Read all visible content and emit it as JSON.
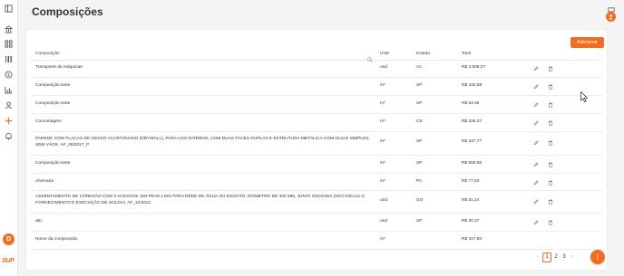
{
  "page": {
    "title": "Composições"
  },
  "brand": {
    "name": "SUP",
    "accent": "#f26d21"
  },
  "user": {
    "initial": "D"
  },
  "sidebar": {
    "items": [
      {
        "icon": "panel-toggle-icon"
      },
      {
        "icon": "bank-icon"
      },
      {
        "icon": "grid-icon"
      },
      {
        "icon": "barcode-icon"
      },
      {
        "icon": "dollar-icon"
      },
      {
        "icon": "bar-chart-icon"
      },
      {
        "icon": "user-icon"
      },
      {
        "icon": "plus-icon"
      },
      {
        "icon": "bell-icon"
      }
    ]
  },
  "toolbar": {
    "add_label": "Adicionar"
  },
  "table": {
    "headers": {
      "composicao": "Composição",
      "und": "UND",
      "estado": "Estado",
      "total": "Total"
    },
    "rows": [
      {
        "composicao": "Transporte de máquinas",
        "und": "und",
        "estado": "AC",
        "total": "R$ 3.508,07"
      },
      {
        "composicao": "Composição teste",
        "und": "m³",
        "estado": "SP",
        "total": "R$ 432,88"
      },
      {
        "composicao": "Composição teste",
        "und": "m³",
        "estado": "SP",
        "total": "R$ 53,48"
      },
      {
        "composicao": "Concretagem",
        "und": "m³",
        "estado": "CE",
        "total": "R$ 228,27"
      },
      {
        "composicao": "PAREDE COM PLACAS DE GESSO ACARTONADO (DRYWALL), PARA USO INTERNO, COM DUAS FACES DUPLAS E ESTRUTURA METÁLICA COM GUIAS SIMPLES, SEM VÃOS. AF_06/2017_P",
        "und": "m²",
        "estado": "SP",
        "total": "R$ 247,77"
      },
      {
        "composicao": "Composição teste",
        "und": "m³",
        "estado": "SP",
        "total": "R$ 558,50"
      },
      {
        "composicao": "Alvenaria",
        "und": "m²",
        "estado": "PA",
        "total": "R$ 77,63"
      },
      {
        "composicao": "ASSENTAMENTO DE CONEXÃO COM 2 ACESSOS, EM PEAD LISO PARA REDE DE ÁGUA OU ESGOTO, DIÂMETRO DE 400 MM, JUNTA SOLDADA (NÃO INCLUI O FORNECIMENTO E EXECUÇÃO DE SOLDA). AF_12/2021",
        "und": "und",
        "estado": "GO",
        "total": "R$ 51,24"
      },
      {
        "composicao": "abc",
        "und": "und",
        "estado": "SP",
        "total": "R$ 20,37"
      },
      {
        "composicao": "Nome da composição",
        "und": "m²",
        "estado": "",
        "total": "R$ 317,60"
      }
    ]
  },
  "pagination": {
    "prev": "‹",
    "pages": [
      "1",
      "2",
      "3"
    ],
    "current": "1",
    "next": "›"
  }
}
